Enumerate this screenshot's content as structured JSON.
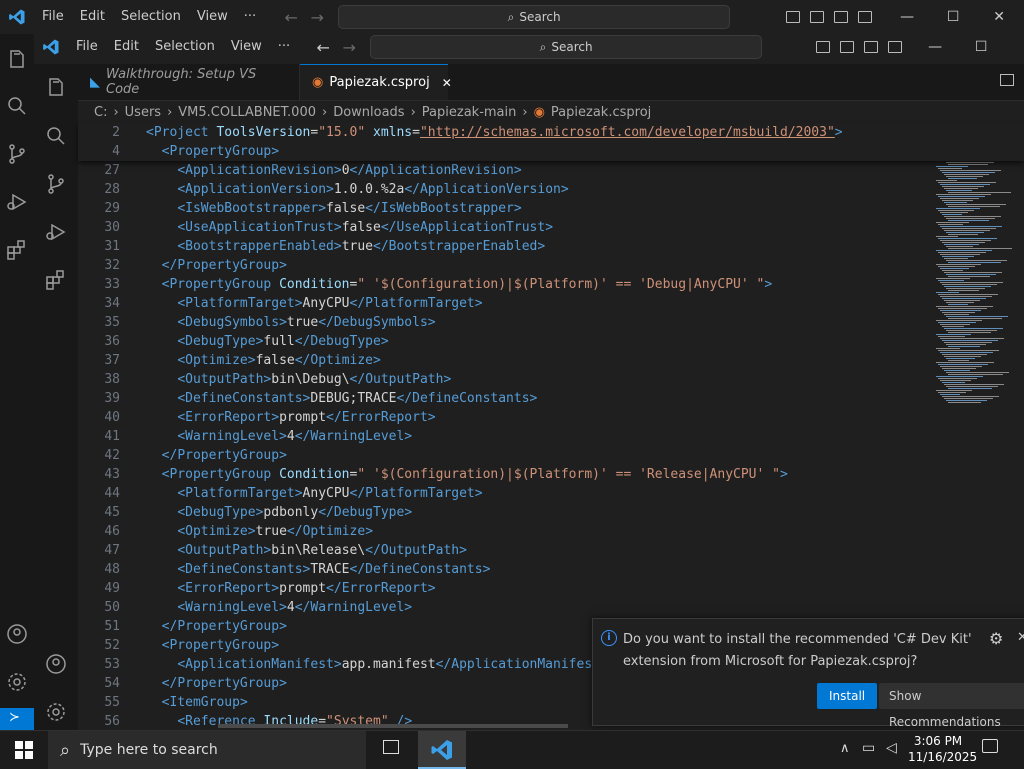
{
  "outer_window": {
    "menu": [
      "File",
      "Edit",
      "Selection",
      "View"
    ],
    "more": "···",
    "search_label": "Search",
    "win_controls": {
      "minimize": "—",
      "maximize": "☐",
      "close": "✕"
    }
  },
  "inner_window": {
    "menu": [
      "File",
      "Edit",
      "Selection",
      "View"
    ],
    "more": "···",
    "search_label": "Search",
    "win_controls": {
      "minimize": "—",
      "maximize": "☐"
    }
  },
  "tabs": [
    {
      "label": "Walkthrough: Setup VS Code",
      "active": false,
      "icon": "vscode-icon"
    },
    {
      "label": "Papiezak.csproj",
      "active": true,
      "icon": "rss-icon",
      "close": "✕"
    }
  ],
  "breadcrumb": [
    "C:",
    "Users",
    "VM5.COLLABNET.000",
    "Downloads",
    "Papiezak-main",
    "Papiezak.csproj"
  ],
  "sticky_lines": [
    {
      "num": "2",
      "html_key": "l2"
    },
    {
      "num": "4",
      "html_key": "l4"
    }
  ],
  "code": {
    "l2_tag_open": "<",
    "l2_tag": "Project",
    "l2_attr1": "ToolsVersion",
    "l2_val1": "\"15.0\"",
    "l2_attr2": "xmlns",
    "l2_val2": "\"http://schemas.microsoft.com/developer/msbuild/2003\"",
    "l4_tag": "PropertyGroup",
    "lines": [
      {
        "num": "27",
        "indent": 4,
        "tag": "ApplicationRevision",
        "text": "0"
      },
      {
        "num": "28",
        "indent": 4,
        "tag": "ApplicationVersion",
        "text": "1.0.0.%2a"
      },
      {
        "num": "29",
        "indent": 4,
        "tag": "IsWebBootstrapper",
        "text": "false"
      },
      {
        "num": "30",
        "indent": 4,
        "tag": "UseApplicationTrust",
        "text": "false"
      },
      {
        "num": "31",
        "indent": 4,
        "tag": "BootstrapperEnabled",
        "text": "true"
      },
      {
        "num": "32",
        "indent": 2,
        "close": "PropertyGroup"
      },
      {
        "num": "33",
        "indent": 2,
        "open": "PropertyGroup",
        "attr": "Condition",
        "val": "\" '$(Configuration)|$(Platform)' == 'Debug|AnyCPU' \""
      },
      {
        "num": "34",
        "indent": 4,
        "tag": "PlatformTarget",
        "text": "AnyCPU"
      },
      {
        "num": "35",
        "indent": 4,
        "tag": "DebugSymbols",
        "text": "true"
      },
      {
        "num": "36",
        "indent": 4,
        "tag": "DebugType",
        "text": "full"
      },
      {
        "num": "37",
        "indent": 4,
        "tag": "Optimize",
        "text": "false"
      },
      {
        "num": "38",
        "indent": 4,
        "tag": "OutputPath",
        "text": "bin\\Debug\\"
      },
      {
        "num": "39",
        "indent": 4,
        "tag": "DefineConstants",
        "text": "DEBUG;TRACE"
      },
      {
        "num": "40",
        "indent": 4,
        "tag": "ErrorReport",
        "text": "prompt"
      },
      {
        "num": "41",
        "indent": 4,
        "tag": "WarningLevel",
        "text": "4"
      },
      {
        "num": "42",
        "indent": 2,
        "close": "PropertyGroup"
      },
      {
        "num": "43",
        "indent": 2,
        "open": "PropertyGroup",
        "attr": "Condition",
        "val": "\" '$(Configuration)|$(Platform)' == 'Release|AnyCPU' \""
      },
      {
        "num": "44",
        "indent": 4,
        "tag": "PlatformTarget",
        "text": "AnyCPU"
      },
      {
        "num": "45",
        "indent": 4,
        "tag": "DebugType",
        "text": "pdbonly"
      },
      {
        "num": "46",
        "indent": 4,
        "tag": "Optimize",
        "text": "true"
      },
      {
        "num": "47",
        "indent": 4,
        "tag": "OutputPath",
        "text": "bin\\Release\\"
      },
      {
        "num": "48",
        "indent": 4,
        "tag": "DefineConstants",
        "text": "TRACE"
      },
      {
        "num": "49",
        "indent": 4,
        "tag": "ErrorReport",
        "text": "prompt"
      },
      {
        "num": "50",
        "indent": 4,
        "tag": "WarningLevel",
        "text": "4"
      },
      {
        "num": "51",
        "indent": 2,
        "close": "PropertyGroup"
      },
      {
        "num": "52",
        "indent": 2,
        "open": "PropertyGroup"
      },
      {
        "num": "53",
        "indent": 4,
        "tag": "ApplicationManifest",
        "text": "app.manifest",
        "truncated": true
      },
      {
        "num": "54",
        "indent": 2,
        "close": "PropertyGroup"
      },
      {
        "num": "55",
        "indent": 2,
        "open": "ItemGroup"
      },
      {
        "num": "56",
        "indent": 4,
        "open": "Reference",
        "attr": "Include",
        "val": "\"System\"",
        "selfclose": true
      }
    ]
  },
  "notification": {
    "line1": "Do you want to install the recommended 'C# Dev Kit'",
    "line2": "extension from Microsoft for Papiezak.csproj?",
    "install": "Install",
    "show": "Show Recommendations"
  },
  "taskbar": {
    "search_placeholder": "Type here to search",
    "time": "3:06 PM",
    "date": "11/16/2025"
  },
  "colors": {
    "accent": "#0078d4",
    "tag": "#569cd6",
    "attr": "#9cdcfe",
    "string": "#ce9178"
  }
}
